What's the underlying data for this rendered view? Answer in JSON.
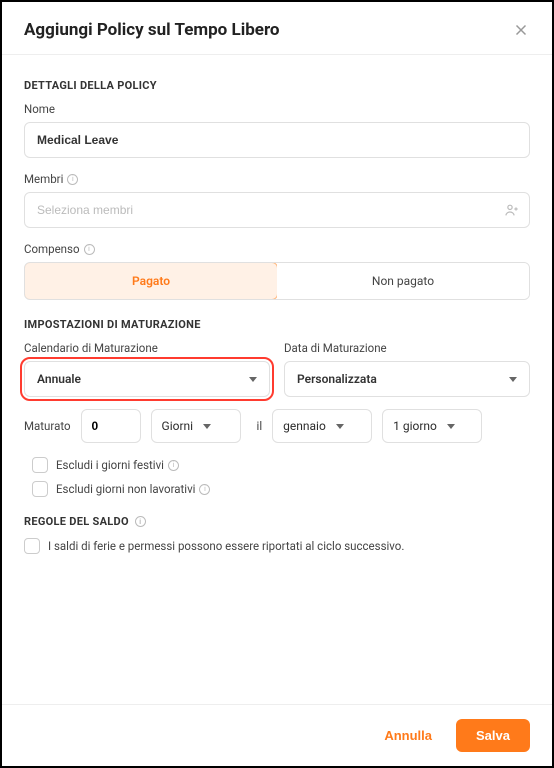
{
  "header": {
    "title": "Aggiungi Policy sul Tempo Libero"
  },
  "sections": {
    "policy_details": "DETTAGLI DELLA POLICY",
    "accrual_settings": "IMPOSTAZIONI DI MATURAZIONE",
    "balance_rules": "REGOLE DEL SALDO"
  },
  "fields": {
    "name_label": "Nome",
    "name_value": "Medical Leave",
    "members_label": "Membri",
    "members_placeholder": "Seleziona membri",
    "compensation_label": "Compenso",
    "compensation": {
      "paid": "Pagato",
      "unpaid": "Non pagato"
    },
    "accrual_schedule_label": "Calendario di Maturazione",
    "accrual_schedule_value": "Annuale",
    "accrual_date_label": "Data di Maturazione",
    "accrual_date_value": "Personalizzata",
    "accrued_label": "Maturato",
    "accrued_value": "0",
    "accrued_unit": "Giorni",
    "on_label": "il",
    "month_value": "gennaio",
    "day_value": "1 giorno",
    "exclude_holidays": "Escludi i giorni festivi",
    "exclude_nonworking": "Escludi giorni non lavorativi",
    "carryover": "I saldi di ferie e permessi possono essere riportati al ciclo successivo."
  },
  "footer": {
    "cancel": "Annulla",
    "save": "Salva"
  }
}
